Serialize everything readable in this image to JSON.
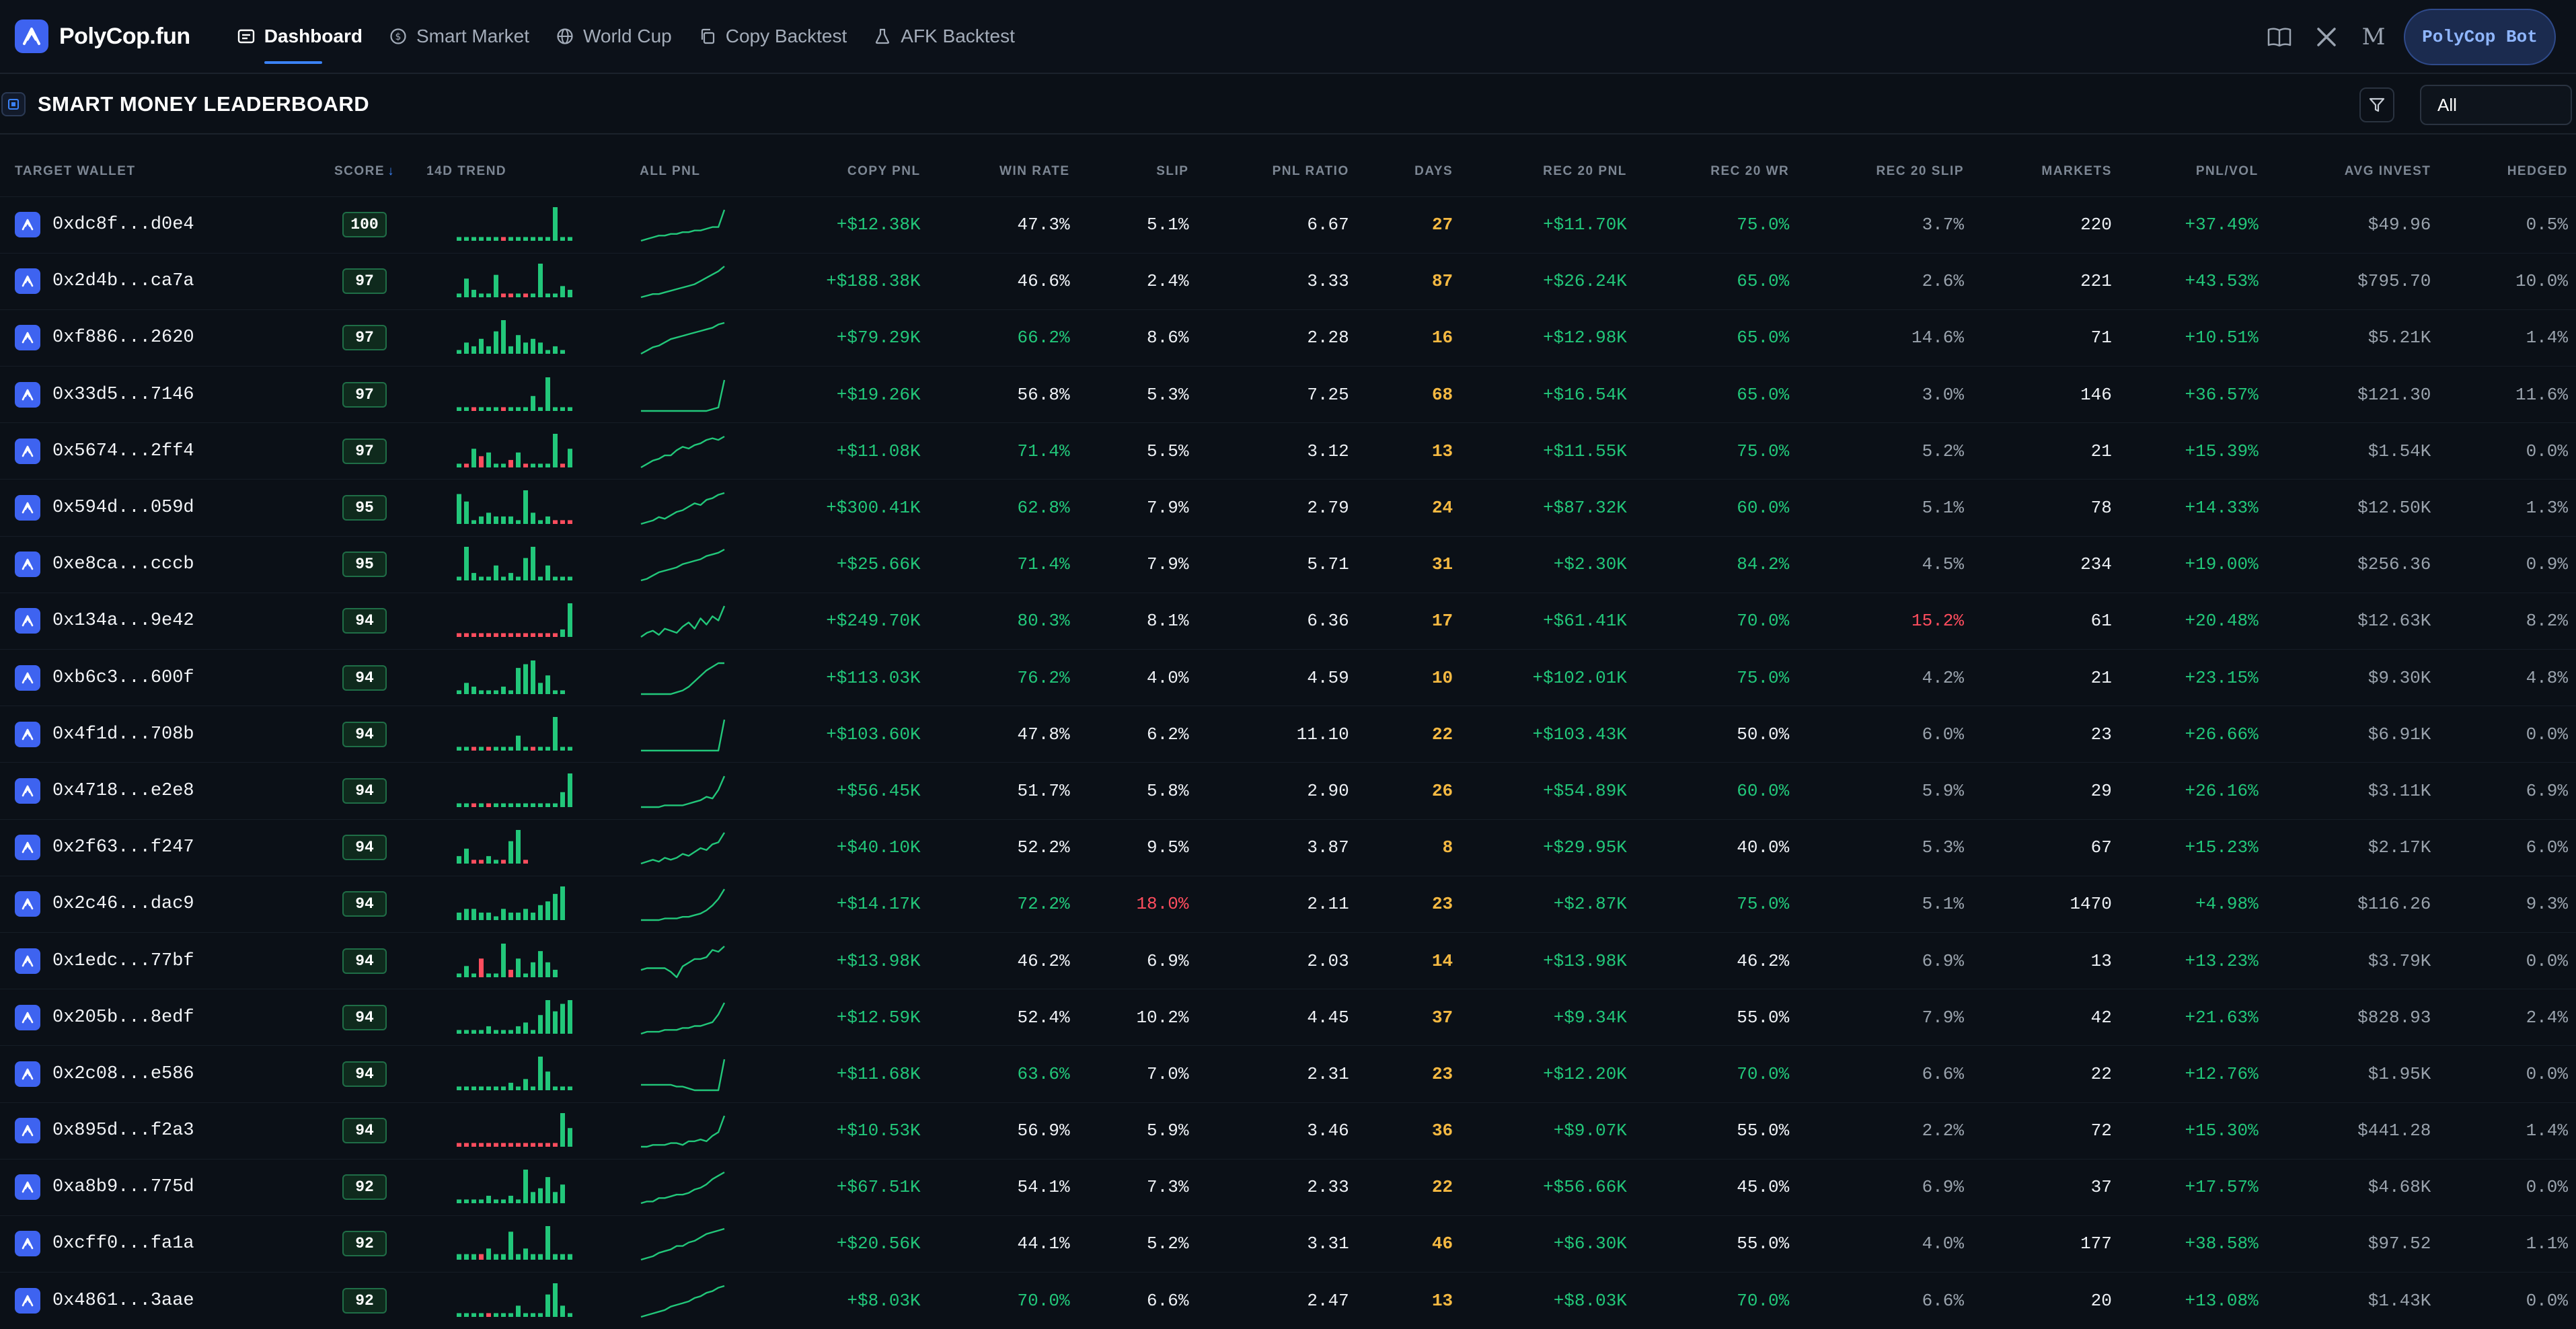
{
  "app": {
    "name": "PolyCop.fun"
  },
  "nav": {
    "items": [
      {
        "label": "Dashboard",
        "icon": "dashboard-icon",
        "active": true
      },
      {
        "label": "Smart Market",
        "icon": "dollar-circle-icon",
        "active": false
      },
      {
        "label": "World Cup",
        "icon": "globe-icon",
        "active": false
      },
      {
        "label": "Copy Backtest",
        "icon": "copy-icon",
        "active": false
      },
      {
        "label": "AFK Backtest",
        "icon": "flask-icon",
        "active": false
      }
    ],
    "right_icons": [
      "docs-book-icon",
      "x-twitter-icon",
      "medium-icon"
    ],
    "medium_glyph": "M",
    "bot_button": "PolyCop Bot"
  },
  "section": {
    "title": "SMART MONEY LEADERBOARD",
    "filter_value": "All"
  },
  "table": {
    "columns": [
      {
        "label": "TARGET WALLET",
        "align": "l"
      },
      {
        "label": "SCORE",
        "align": "c",
        "sorted": "desc"
      },
      {
        "label": "14D TREND",
        "align": "l"
      },
      {
        "label": "ALL PNL",
        "align": "l"
      },
      {
        "label": "COPY PNL",
        "align": "r"
      },
      {
        "label": "WIN RATE",
        "align": "r"
      },
      {
        "label": "SLIP",
        "align": "r"
      },
      {
        "label": "PNL RATIO",
        "align": "r"
      },
      {
        "label": "DAYS",
        "align": "r"
      },
      {
        "label": "REC 20 PNL",
        "align": "r"
      },
      {
        "label": "REC 20 WR",
        "align": "r"
      },
      {
        "label": "REC 20 SLIP",
        "align": "r"
      },
      {
        "label": "MARKETS",
        "align": "r"
      },
      {
        "label": "PNL/VOL",
        "align": "r"
      },
      {
        "label": "AVG INVEST",
        "align": "r"
      },
      {
        "label": "HEDGED",
        "align": "r"
      }
    ],
    "rows": [
      {
        "wallet": "0xdc8f...d0e4",
        "score": "100",
        "copy_pnl": "+$12.38K",
        "win_rate": "47.3%",
        "slip": "5.1%",
        "pnl_ratio": "6.67",
        "days": "27",
        "rec20_pnl": "+$11.70K",
        "rec20_wr": "75.0%",
        "rec20_slip": "3.7%",
        "markets": "220",
        "pnl_vol": "+37.49%",
        "avg_invest": "$49.96",
        "hedged": "0.5%",
        "trend": [
          1,
          1,
          1,
          1,
          1,
          1,
          -1,
          1,
          1,
          1,
          1,
          1,
          1,
          9,
          1,
          1
        ],
        "pnl": [
          2,
          3,
          4,
          5,
          5,
          6,
          6,
          7,
          7,
          8,
          8,
          9,
          10,
          10,
          20
        ]
      },
      {
        "wallet": "0x2d4b...ca7a",
        "score": "97",
        "copy_pnl": "+$188.38K",
        "win_rate": "46.6%",
        "slip": "2.4%",
        "pnl_ratio": "3.33",
        "days": "87",
        "rec20_pnl": "+$26.24K",
        "rec20_wr": "65.0%",
        "rec20_slip": "2.6%",
        "markets": "221",
        "pnl_vol": "+43.53%",
        "avg_invest": "$795.70",
        "hedged": "10.0%",
        "trend": [
          1,
          5,
          2,
          1,
          1,
          6,
          -1,
          -1,
          1,
          -1,
          1,
          9,
          1,
          1,
          3,
          2
        ],
        "pnl": [
          1,
          2,
          3,
          3,
          4,
          5,
          6,
          7,
          8,
          9,
          11,
          13,
          15,
          17,
          20
        ]
      },
      {
        "wallet": "0xf886...2620",
        "score": "97",
        "copy_pnl": "+$79.29K",
        "win_rate": "66.2%",
        "slip": "8.6%",
        "pnl_ratio": "2.28",
        "days": "16",
        "rec20_pnl": "+$12.98K",
        "rec20_wr": "65.0%",
        "rec20_slip": "14.6%",
        "markets": "71",
        "pnl_vol": "+10.51%",
        "avg_invest": "$5.21K",
        "hedged": "1.4%",
        "trend": [
          1,
          3,
          2,
          4,
          2,
          6,
          9,
          2,
          5,
          3,
          4,
          3,
          1,
          2,
          1
        ],
        "pnl": [
          1,
          3,
          5,
          6,
          8,
          10,
          11,
          12,
          13,
          14,
          15,
          16,
          17,
          19,
          20
        ]
      },
      {
        "wallet": "0x33d5...7146",
        "score": "97",
        "copy_pnl": "+$19.26K",
        "win_rate": "56.8%",
        "slip": "5.3%",
        "pnl_ratio": "7.25",
        "days": "68",
        "rec20_pnl": "+$16.54K",
        "rec20_wr": "65.0%",
        "rec20_slip": "3.0%",
        "markets": "146",
        "pnl_vol": "+36.57%",
        "avg_invest": "$121.30",
        "hedged": "11.6%",
        "trend": [
          1,
          1,
          -1,
          1,
          1,
          1,
          -1,
          1,
          1,
          1,
          4,
          1,
          9,
          1,
          1,
          1
        ],
        "pnl": [
          2,
          2,
          2,
          2,
          2,
          2,
          2,
          2,
          2,
          2,
          2,
          2,
          3,
          4,
          20
        ]
      },
      {
        "wallet": "0x5674...2ff4",
        "score": "97",
        "copy_pnl": "+$11.08K",
        "win_rate": "71.4%",
        "slip": "5.5%",
        "pnl_ratio": "3.12",
        "days": "13",
        "rec20_pnl": "+$11.55K",
        "rec20_wr": "75.0%",
        "rec20_slip": "5.2%",
        "markets": "21",
        "pnl_vol": "+15.39%",
        "avg_invest": "$1.54K",
        "hedged": "0.0%",
        "trend": [
          1,
          -1,
          5,
          -3,
          4,
          1,
          1,
          -2,
          4,
          -1,
          1,
          1,
          1,
          9,
          -1,
          5
        ],
        "pnl": [
          2,
          4,
          6,
          7,
          9,
          9,
          12,
          14,
          13,
          15,
          16,
          18,
          19,
          18,
          20
        ]
      },
      {
        "wallet": "0x594d...059d",
        "score": "95",
        "copy_pnl": "+$300.41K",
        "win_rate": "62.8%",
        "slip": "7.9%",
        "pnl_ratio": "2.79",
        "days": "24",
        "rec20_pnl": "+$87.32K",
        "rec20_wr": "60.0%",
        "rec20_slip": "5.1%",
        "markets": "78",
        "pnl_vol": "+14.33%",
        "avg_invest": "$12.50K",
        "hedged": "1.3%",
        "trend": [
          8,
          6,
          1,
          2,
          3,
          2,
          2,
          2,
          1,
          9,
          3,
          1,
          2,
          -1,
          -1,
          -1
        ],
        "pnl": [
          2,
          3,
          4,
          6,
          5,
          7,
          9,
          10,
          12,
          14,
          13,
          16,
          17,
          19,
          20
        ]
      },
      {
        "wallet": "0xe8ca...cccb",
        "score": "95",
        "copy_pnl": "+$25.66K",
        "win_rate": "71.4%",
        "slip": "7.9%",
        "pnl_ratio": "5.71",
        "days": "31",
        "rec20_pnl": "+$2.30K",
        "rec20_wr": "84.2%",
        "rec20_slip": "4.5%",
        "markets": "234",
        "pnl_vol": "+19.00%",
        "avg_invest": "$256.36",
        "hedged": "0.9%",
        "trend": [
          1,
          9,
          2,
          1,
          1,
          4,
          1,
          2,
          1,
          6,
          9,
          1,
          4,
          1,
          1,
          1
        ],
        "pnl": [
          1,
          2,
          4,
          6,
          7,
          8,
          9,
          11,
          12,
          13,
          14,
          16,
          17,
          18,
          20
        ]
      },
      {
        "wallet": "0x134a...9e42",
        "score": "94",
        "copy_pnl": "+$249.70K",
        "win_rate": "80.3%",
        "slip": "8.1%",
        "pnl_ratio": "6.36",
        "days": "17",
        "rec20_pnl": "+$61.41K",
        "rec20_wr": "70.0%",
        "rec20_slip": "15.2%",
        "markets": "61",
        "pnl_vol": "+20.48%",
        "avg_invest": "$12.63K",
        "hedged": "8.2%",
        "trend": [
          -1,
          -1,
          -1,
          -1,
          -1,
          -1,
          -1,
          -1,
          -1,
          -1,
          -1,
          -1,
          -1,
          -1,
          2,
          9
        ],
        "pnl": [
          5,
          7,
          8,
          6,
          9,
          8,
          7,
          10,
          12,
          9,
          14,
          11,
          15,
          13,
          20
        ]
      },
      {
        "wallet": "0xb6c3...600f",
        "score": "94",
        "copy_pnl": "+$113.03K",
        "win_rate": "76.2%",
        "slip": "4.0%",
        "pnl_ratio": "4.59",
        "days": "10",
        "rec20_pnl": "+$102.01K",
        "rec20_wr": "75.0%",
        "rec20_slip": "4.2%",
        "markets": "21",
        "pnl_vol": "+23.15%",
        "avg_invest": "$9.30K",
        "hedged": "4.8%",
        "trend": [
          1,
          3,
          2,
          1,
          1,
          1,
          2,
          1,
          7,
          8,
          9,
          3,
          5,
          1,
          1
        ],
        "pnl": [
          3,
          3,
          3,
          3,
          3,
          3,
          4,
          5,
          7,
          10,
          13,
          16,
          18,
          20,
          20
        ]
      },
      {
        "wallet": "0x4f1d...708b",
        "score": "94",
        "copy_pnl": "+$103.60K",
        "win_rate": "47.8%",
        "slip": "6.2%",
        "pnl_ratio": "11.10",
        "days": "22",
        "rec20_pnl": "+$103.43K",
        "rec20_wr": "50.0%",
        "rec20_slip": "6.0%",
        "markets": "23",
        "pnl_vol": "+26.66%",
        "avg_invest": "$6.91K",
        "hedged": "0.0%",
        "trend": [
          1,
          1,
          -1,
          1,
          -1,
          1,
          1,
          1,
          4,
          1,
          -1,
          1,
          1,
          9,
          1,
          1
        ],
        "pnl": [
          2,
          2,
          2,
          2,
          2,
          2,
          2,
          2,
          2,
          2,
          2,
          2,
          2,
          2,
          20
        ]
      },
      {
        "wallet": "0x4718...e2e8",
        "score": "94",
        "copy_pnl": "+$56.45K",
        "win_rate": "51.7%",
        "slip": "5.8%",
        "pnl_ratio": "2.90",
        "days": "26",
        "rec20_pnl": "+$54.89K",
        "rec20_wr": "60.0%",
        "rec20_slip": "5.9%",
        "markets": "29",
        "pnl_vol": "+26.16%",
        "avg_invest": "$3.11K",
        "hedged": "6.9%",
        "trend": [
          1,
          1,
          -1,
          1,
          -1,
          1,
          1,
          1,
          1,
          1,
          1,
          1,
          1,
          1,
          4,
          9
        ],
        "pnl": [
          2,
          2,
          2,
          2,
          3,
          3,
          3,
          3,
          4,
          5,
          6,
          8,
          7,
          12,
          20
        ]
      },
      {
        "wallet": "0x2f63...f247",
        "score": "94",
        "copy_pnl": "+$40.10K",
        "win_rate": "52.2%",
        "slip": "9.5%",
        "pnl_ratio": "3.87",
        "days": "8",
        "rec20_pnl": "+$29.95K",
        "rec20_wr": "40.0%",
        "rec20_slip": "5.3%",
        "markets": "67",
        "pnl_vol": "+15.23%",
        "avg_invest": "$2.17K",
        "hedged": "6.0%",
        "trend": [
          2,
          4,
          -1,
          -1,
          2,
          1,
          -1,
          6,
          9,
          -1
        ],
        "pnl": [
          4,
          5,
          6,
          5,
          7,
          6,
          7,
          9,
          8,
          10,
          12,
          11,
          14,
          15,
          20
        ]
      },
      {
        "wallet": "0x2c46...dac9",
        "score": "94",
        "copy_pnl": "+$14.17K",
        "win_rate": "72.2%",
        "slip": "18.0%",
        "pnl_ratio": "2.11",
        "days": "23",
        "rec20_pnl": "+$2.87K",
        "rec20_wr": "75.0%",
        "rec20_slip": "5.1%",
        "markets": "1470",
        "pnl_vol": "+4.98%",
        "avg_invest": "$116.26",
        "hedged": "9.3%",
        "trend": [
          2,
          3,
          3,
          2,
          2,
          1,
          3,
          2,
          2,
          3,
          2,
          4,
          5,
          7,
          9
        ],
        "pnl": [
          1,
          1,
          1,
          1,
          2,
          2,
          2,
          3,
          3,
          4,
          5,
          7,
          10,
          14,
          20
        ]
      },
      {
        "wallet": "0x1edc...77bf",
        "score": "94",
        "copy_pnl": "+$13.98K",
        "win_rate": "46.2%",
        "slip": "6.9%",
        "pnl_ratio": "2.03",
        "days": "14",
        "rec20_pnl": "+$13.98K",
        "rec20_wr": "46.2%",
        "rec20_slip": "6.9%",
        "markets": "13",
        "pnl_vol": "+13.23%",
        "avg_invest": "$3.79K",
        "hedged": "0.0%",
        "trend": [
          1,
          3,
          1,
          -5,
          1,
          1,
          9,
          -2,
          5,
          1,
          4,
          7,
          4,
          2
        ],
        "pnl": [
          7,
          8,
          8,
          8,
          8,
          6,
          3,
          9,
          11,
          13,
          13,
          14,
          18,
          17,
          20
        ]
      },
      {
        "wallet": "0x205b...8edf",
        "score": "94",
        "copy_pnl": "+$12.59K",
        "win_rate": "52.4%",
        "slip": "10.2%",
        "pnl_ratio": "4.45",
        "days": "37",
        "rec20_pnl": "+$9.34K",
        "rec20_wr": "55.0%",
        "rec20_slip": "7.9%",
        "markets": "42",
        "pnl_vol": "+21.63%",
        "avg_invest": "$828.93",
        "hedged": "2.4%",
        "trend": [
          1,
          1,
          1,
          1,
          2,
          1,
          1,
          1,
          2,
          3,
          1,
          5,
          9,
          6,
          8,
          9
        ],
        "pnl": [
          4,
          5,
          5,
          5,
          6,
          6,
          6,
          7,
          7,
          8,
          8,
          9,
          10,
          14,
          20
        ]
      },
      {
        "wallet": "0x2c08...e586",
        "score": "94",
        "copy_pnl": "+$11.68K",
        "win_rate": "63.6%",
        "slip": "7.0%",
        "pnl_ratio": "2.31",
        "days": "23",
        "rec20_pnl": "+$12.20K",
        "rec20_wr": "70.0%",
        "rec20_slip": "6.6%",
        "markets": "22",
        "pnl_vol": "+12.76%",
        "avg_invest": "$1.95K",
        "hedged": "0.0%",
        "trend": [
          1,
          1,
          1,
          1,
          1,
          1,
          1,
          2,
          1,
          3,
          1,
          9,
          5,
          1,
          1,
          1
        ],
        "pnl": [
          6,
          6,
          6,
          6,
          6,
          6,
          5,
          5,
          4,
          3,
          3,
          3,
          3,
          3,
          20
        ]
      },
      {
        "wallet": "0x895d...f2a3",
        "score": "94",
        "copy_pnl": "+$10.53K",
        "win_rate": "56.9%",
        "slip": "5.9%",
        "pnl_ratio": "3.46",
        "days": "36",
        "rec20_pnl": "+$9.07K",
        "rec20_wr": "55.0%",
        "rec20_slip": "2.2%",
        "markets": "72",
        "pnl_vol": "+15.30%",
        "avg_invest": "$441.28",
        "hedged": "1.4%",
        "trend": [
          -1,
          -1,
          -1,
          -1,
          -1,
          -1,
          -1,
          -1,
          -1,
          -1,
          -1,
          -1,
          -1,
          -1,
          9,
          5
        ],
        "pnl": [
          3,
          3,
          4,
          4,
          4,
          5,
          5,
          4,
          6,
          6,
          7,
          6,
          9,
          11,
          20
        ]
      },
      {
        "wallet": "0xa8b9...775d",
        "score": "92",
        "copy_pnl": "+$67.51K",
        "win_rate": "54.1%",
        "slip": "7.3%",
        "pnl_ratio": "2.33",
        "days": "22",
        "rec20_pnl": "+$56.66K",
        "rec20_wr": "45.0%",
        "rec20_slip": "6.9%",
        "markets": "37",
        "pnl_vol": "+17.57%",
        "avg_invest": "$4.68K",
        "hedged": "0.0%",
        "trend": [
          1,
          1,
          1,
          1,
          2,
          1,
          1,
          2,
          1,
          9,
          3,
          4,
          7,
          3,
          5
        ],
        "pnl": [
          2,
          3,
          3,
          5,
          5,
          6,
          7,
          7,
          8,
          10,
          11,
          13,
          16,
          18,
          20
        ]
      },
      {
        "wallet": "0xcff0...fa1a",
        "score": "92",
        "copy_pnl": "+$20.56K",
        "win_rate": "44.1%",
        "slip": "5.2%",
        "pnl_ratio": "3.31",
        "days": "46",
        "rec20_pnl": "+$6.30K",
        "rec20_wr": "55.0%",
        "rec20_slip": "4.0%",
        "markets": "177",
        "pnl_vol": "+38.58%",
        "avg_invest": "$97.52",
        "hedged": "1.1%",
        "trend": [
          1,
          1,
          1,
          -1,
          2,
          1,
          1,
          5,
          1,
          2,
          1,
          1,
          6,
          1,
          1,
          1
        ],
        "pnl": [
          2,
          3,
          4,
          6,
          7,
          8,
          10,
          10,
          12,
          13,
          15,
          17,
          18,
          19,
          20
        ]
      },
      {
        "wallet": "0x4861...3aae",
        "score": "92",
        "copy_pnl": "+$8.03K",
        "win_rate": "70.0%",
        "slip": "6.6%",
        "pnl_ratio": "2.47",
        "days": "13",
        "rec20_pnl": "+$8.03K",
        "rec20_wr": "70.0%",
        "rec20_slip": "6.6%",
        "markets": "20",
        "pnl_vol": "+13.08%",
        "avg_invest": "$1.43K",
        "hedged": "0.0%",
        "trend": [
          1,
          1,
          1,
          1,
          -1,
          1,
          1,
          1,
          3,
          1,
          1,
          1,
          6,
          9,
          3,
          1
        ],
        "pnl": [
          2,
          3,
          4,
          5,
          6,
          8,
          9,
          10,
          11,
          13,
          14,
          16,
          17,
          19,
          20
        ]
      }
    ]
  },
  "colors": {
    "positive": "#22c77a",
    "negative": "#ff4d5e",
    "amber": "#f5b942",
    "accent": "#3e63f0",
    "background": "#0b1017"
  }
}
